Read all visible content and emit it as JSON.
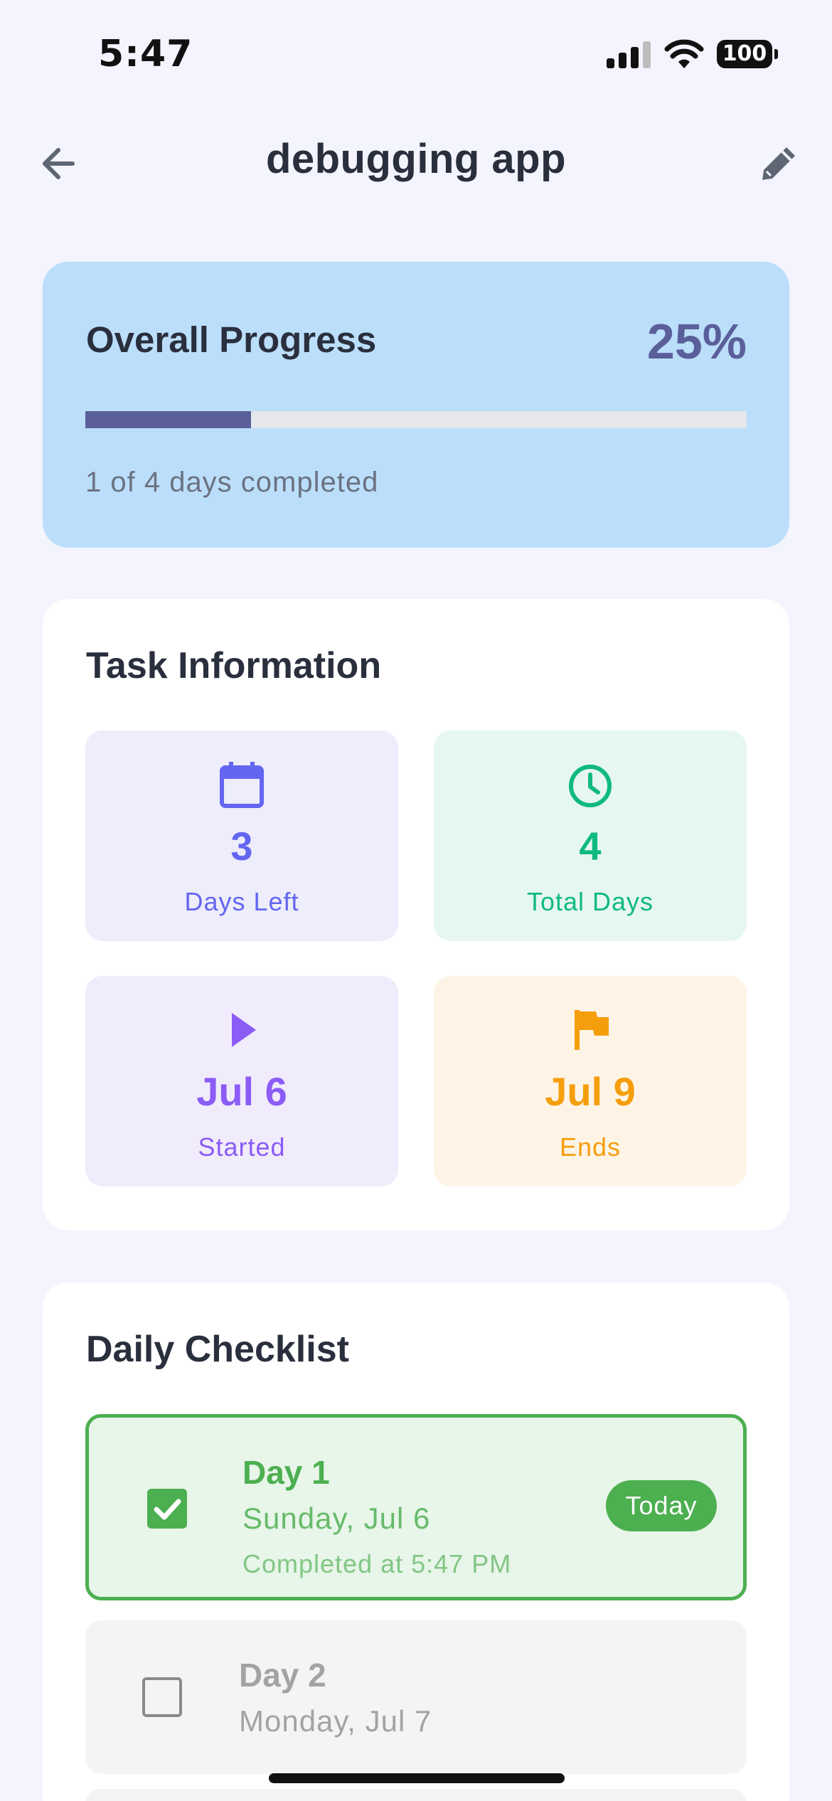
{
  "status_bar": {
    "time": "5:47",
    "battery": "100",
    "icons": [
      "signal-icon",
      "wifi-icon",
      "battery-icon"
    ]
  },
  "header": {
    "title": "debugging app",
    "back_icon": "arrow-left-icon",
    "edit_icon": "pencil-icon"
  },
  "progress": {
    "title": "Overall Progress",
    "percent_label": "25%",
    "percent_value": 0.25,
    "subtitle": "1 of 4 days completed",
    "colors": {
      "card": "#BBDEFB",
      "fill": "#5A5F9A",
      "track": "#E5E7EB"
    }
  },
  "task_info": {
    "title": "Task Information",
    "tiles": [
      {
        "icon": "calendar-icon",
        "value": "3",
        "label": "Days Left",
        "color": "#6366F1",
        "bg": "#EEEDFB"
      },
      {
        "icon": "clock-icon",
        "value": "4",
        "label": "Total Days",
        "color": "#10B981",
        "bg": "#E6F7F0"
      },
      {
        "icon": "play-icon",
        "value": "Jul 6",
        "label": "Started",
        "color": "#8B5CF6",
        "bg": "#F1ECFC"
      },
      {
        "icon": "flag-icon",
        "value": "Jul 9",
        "label": "Ends",
        "color": "#F59E0B",
        "bg": "#FEF4E6"
      }
    ]
  },
  "checklist": {
    "title": "Daily Checklist",
    "items": [
      {
        "title": "Day 1",
        "date": "Sunday, Jul 6",
        "note": "Completed at 5:47 PM",
        "checked": true,
        "badge": "Today"
      },
      {
        "title": "Day 2",
        "date": "Monday, Jul 7",
        "checked": false
      }
    ]
  }
}
